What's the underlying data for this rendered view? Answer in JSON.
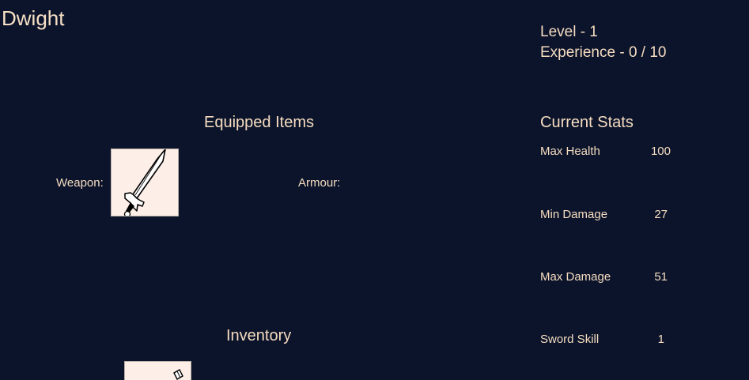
{
  "character": {
    "name": "Dwight",
    "level_text": "Level - 1",
    "experience_text": "Experience - 0 / 10"
  },
  "equipment": {
    "title": "Equipped Items",
    "weapon_label": "Weapon:",
    "armour_label": "Armour:",
    "weapon_icon": "sword-icon"
  },
  "inventory": {
    "title": "Inventory",
    "items": [
      {
        "icon": "item-icon"
      }
    ]
  },
  "stats": {
    "title": "Current Stats",
    "items": [
      {
        "name": "Max Health",
        "value": "100"
      },
      {
        "name": "Min Damage",
        "value": "27"
      },
      {
        "name": "Max Damage",
        "value": "51"
      },
      {
        "name": "Sword Skill",
        "value": "1"
      }
    ]
  },
  "colors": {
    "background": "#0b142b",
    "text": "#f6dcc0",
    "slot_background": "#fdeee7"
  }
}
